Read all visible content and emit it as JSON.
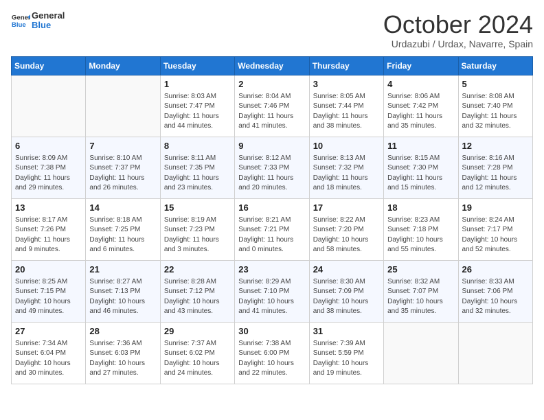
{
  "header": {
    "logo_general": "General",
    "logo_blue": "Blue",
    "month": "October 2024",
    "location": "Urdazubi / Urdax, Navarre, Spain"
  },
  "weekdays": [
    "Sunday",
    "Monday",
    "Tuesday",
    "Wednesday",
    "Thursday",
    "Friday",
    "Saturday"
  ],
  "weeks": [
    [
      {
        "day": "",
        "info": ""
      },
      {
        "day": "",
        "info": ""
      },
      {
        "day": "1",
        "info": "Sunrise: 8:03 AM\nSunset: 7:47 PM\nDaylight: 11 hours and 44 minutes."
      },
      {
        "day": "2",
        "info": "Sunrise: 8:04 AM\nSunset: 7:46 PM\nDaylight: 11 hours and 41 minutes."
      },
      {
        "day": "3",
        "info": "Sunrise: 8:05 AM\nSunset: 7:44 PM\nDaylight: 11 hours and 38 minutes."
      },
      {
        "day": "4",
        "info": "Sunrise: 8:06 AM\nSunset: 7:42 PM\nDaylight: 11 hours and 35 minutes."
      },
      {
        "day": "5",
        "info": "Sunrise: 8:08 AM\nSunset: 7:40 PM\nDaylight: 11 hours and 32 minutes."
      }
    ],
    [
      {
        "day": "6",
        "info": "Sunrise: 8:09 AM\nSunset: 7:38 PM\nDaylight: 11 hours and 29 minutes."
      },
      {
        "day": "7",
        "info": "Sunrise: 8:10 AM\nSunset: 7:37 PM\nDaylight: 11 hours and 26 minutes."
      },
      {
        "day": "8",
        "info": "Sunrise: 8:11 AM\nSunset: 7:35 PM\nDaylight: 11 hours and 23 minutes."
      },
      {
        "day": "9",
        "info": "Sunrise: 8:12 AM\nSunset: 7:33 PM\nDaylight: 11 hours and 20 minutes."
      },
      {
        "day": "10",
        "info": "Sunrise: 8:13 AM\nSunset: 7:32 PM\nDaylight: 11 hours and 18 minutes."
      },
      {
        "day": "11",
        "info": "Sunrise: 8:15 AM\nSunset: 7:30 PM\nDaylight: 11 hours and 15 minutes."
      },
      {
        "day": "12",
        "info": "Sunrise: 8:16 AM\nSunset: 7:28 PM\nDaylight: 11 hours and 12 minutes."
      }
    ],
    [
      {
        "day": "13",
        "info": "Sunrise: 8:17 AM\nSunset: 7:26 PM\nDaylight: 11 hours and 9 minutes."
      },
      {
        "day": "14",
        "info": "Sunrise: 8:18 AM\nSunset: 7:25 PM\nDaylight: 11 hours and 6 minutes."
      },
      {
        "day": "15",
        "info": "Sunrise: 8:19 AM\nSunset: 7:23 PM\nDaylight: 11 hours and 3 minutes."
      },
      {
        "day": "16",
        "info": "Sunrise: 8:21 AM\nSunset: 7:21 PM\nDaylight: 11 hours and 0 minutes."
      },
      {
        "day": "17",
        "info": "Sunrise: 8:22 AM\nSunset: 7:20 PM\nDaylight: 10 hours and 58 minutes."
      },
      {
        "day": "18",
        "info": "Sunrise: 8:23 AM\nSunset: 7:18 PM\nDaylight: 10 hours and 55 minutes."
      },
      {
        "day": "19",
        "info": "Sunrise: 8:24 AM\nSunset: 7:17 PM\nDaylight: 10 hours and 52 minutes."
      }
    ],
    [
      {
        "day": "20",
        "info": "Sunrise: 8:25 AM\nSunset: 7:15 PM\nDaylight: 10 hours and 49 minutes."
      },
      {
        "day": "21",
        "info": "Sunrise: 8:27 AM\nSunset: 7:13 PM\nDaylight: 10 hours and 46 minutes."
      },
      {
        "day": "22",
        "info": "Sunrise: 8:28 AM\nSunset: 7:12 PM\nDaylight: 10 hours and 43 minutes."
      },
      {
        "day": "23",
        "info": "Sunrise: 8:29 AM\nSunset: 7:10 PM\nDaylight: 10 hours and 41 minutes."
      },
      {
        "day": "24",
        "info": "Sunrise: 8:30 AM\nSunset: 7:09 PM\nDaylight: 10 hours and 38 minutes."
      },
      {
        "day": "25",
        "info": "Sunrise: 8:32 AM\nSunset: 7:07 PM\nDaylight: 10 hours and 35 minutes."
      },
      {
        "day": "26",
        "info": "Sunrise: 8:33 AM\nSunset: 7:06 PM\nDaylight: 10 hours and 32 minutes."
      }
    ],
    [
      {
        "day": "27",
        "info": "Sunrise: 7:34 AM\nSunset: 6:04 PM\nDaylight: 10 hours and 30 minutes."
      },
      {
        "day": "28",
        "info": "Sunrise: 7:36 AM\nSunset: 6:03 PM\nDaylight: 10 hours and 27 minutes."
      },
      {
        "day": "29",
        "info": "Sunrise: 7:37 AM\nSunset: 6:02 PM\nDaylight: 10 hours and 24 minutes."
      },
      {
        "day": "30",
        "info": "Sunrise: 7:38 AM\nSunset: 6:00 PM\nDaylight: 10 hours and 22 minutes."
      },
      {
        "day": "31",
        "info": "Sunrise: 7:39 AM\nSunset: 5:59 PM\nDaylight: 10 hours and 19 minutes."
      },
      {
        "day": "",
        "info": ""
      },
      {
        "day": "",
        "info": ""
      }
    ]
  ]
}
